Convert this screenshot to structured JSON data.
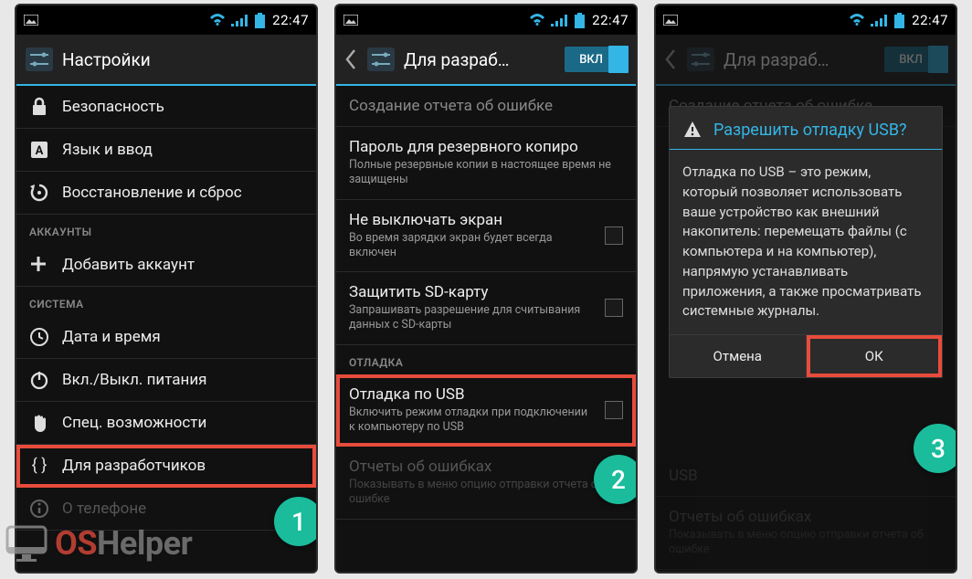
{
  "status": {
    "time": "22:47"
  },
  "screen1": {
    "title": "Настройки",
    "items": [
      {
        "icon": "lock-icon",
        "label": "Безопасность"
      },
      {
        "icon": "language-icon",
        "label": "Язык и ввод"
      },
      {
        "icon": "restore-icon",
        "label": "Восстановление и сброс"
      }
    ],
    "section_accounts": "АККАУНТЫ",
    "add_account": "Добавить аккаунт",
    "section_system": "СИСТЕМА",
    "system_items": [
      {
        "icon": "clock-icon",
        "label": "Дата и время"
      },
      {
        "icon": "power-icon",
        "label": "Вкл./Выкл. питания"
      },
      {
        "icon": "hand-icon",
        "label": "Спец. возможности"
      },
      {
        "icon": "braces-icon",
        "label": "Для разработчиков"
      },
      {
        "icon": "info-icon",
        "label": "О телефоне"
      }
    ]
  },
  "screen2": {
    "title": "Для разраб…",
    "toggle_label": "ВКЛ",
    "items": [
      {
        "label": "Создание отчета об ошибке",
        "sub": "",
        "disabled": true
      },
      {
        "label": "Пароль для резервного копиро",
        "sub": "Полные резервные копии в настоящее время не защищены"
      },
      {
        "label": "Не выключать экран",
        "sub": "Во время зарядки экран будет всегда включен",
        "check": true
      },
      {
        "label": "Защитить SD-карту",
        "sub": "Запрашивать разрешение для считывания данных с SD-карты",
        "check": true
      }
    ],
    "section_debug": "ОТЛАДКА",
    "debug_items": [
      {
        "label": "Отладка по USB",
        "sub": "Включить режим отладки при подключении к компьютеру по USB",
        "check": true
      },
      {
        "label": "Отчеты об ошибках",
        "sub": "Показывать в меню опцию отправки отчета об ошибке",
        "faded": true
      }
    ]
  },
  "screen3": {
    "title": "Для разраб…",
    "toggle_label": "ВКЛ",
    "dialog": {
      "title": "Разрешить отладку USB?",
      "body": "Отладка по USB – это режим, который позволяет использовать ваше устройство как внешний накопитель: перемещать файлы (с компьютера и на компьютер), напрямую устанавливать приложения, а также просматривать системные журналы.",
      "cancel": "Отмена",
      "ok": "ОК"
    },
    "bg_usb": {
      "label": "USB",
      "sub": ""
    },
    "bg_reports": {
      "label": "Отчеты об ошибках",
      "sub": "Показывать в меню опцию отправки отчета об ошибке"
    }
  },
  "badges": [
    "1",
    "2",
    "3"
  ],
  "watermark": {
    "left": "OS",
    "right": "Helper"
  }
}
